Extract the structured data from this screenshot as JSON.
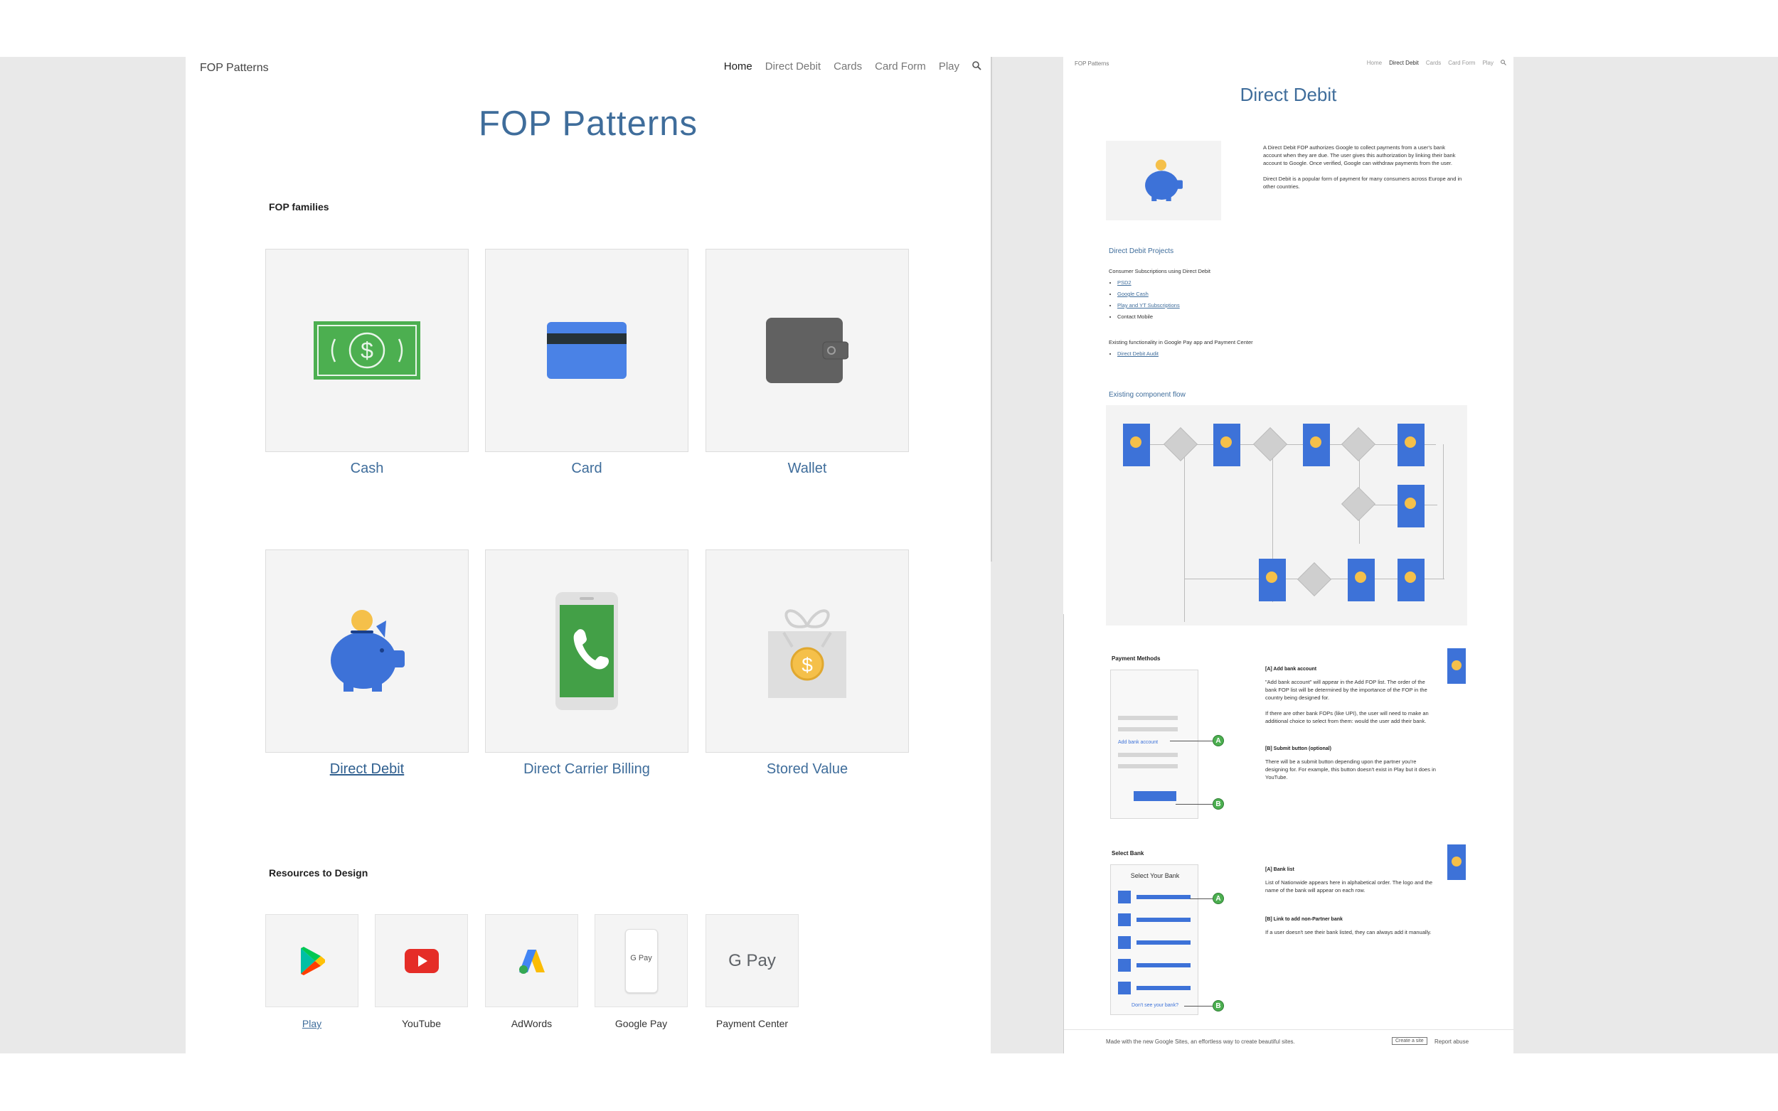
{
  "left_page": {
    "site_name": "FOP Patterns",
    "nav": [
      "Home",
      "Direct Debit",
      "Cards",
      "Card Form",
      "Play"
    ],
    "title": "FOP Patterns",
    "families_heading": "FOP families",
    "families": [
      "Cash",
      "Card",
      "Wallet",
      "Direct Debit",
      "Direct Carrier Billing",
      "Stored Value"
    ],
    "resources_heading": "Resources to Design",
    "resources": [
      "Play",
      "YouTube",
      "AdWords",
      "Google Pay",
      "Payment Center"
    ],
    "gpay_text": "G Pay",
    "gpay_small": "G Pay"
  },
  "right_page": {
    "site_name": "FOP Patterns",
    "nav": [
      "Home",
      "Direct Debit",
      "Cards",
      "Card Form",
      "Play"
    ],
    "title": "Direct Debit",
    "intro_1": "A Direct Debit FOP authorizes Google to collect payments from a user's bank account when they are due. The user gives this authorization by linking their bank account to Google. Once verified, Google can withdraw payments from the user.",
    "intro_2": "Direct Debit is a popular form of payment for many consumers across Europe and in other countries.",
    "projects_heading": "Direct Debit Projects",
    "projects_sub": "Consumer Subscriptions using Direct Debit",
    "projects_list": [
      "PSD2",
      "Google Cash",
      "Play and YT Subscriptions",
      "Contact Mobile"
    ],
    "existing_text": "Existing functionality in Google Pay app and Payment Center",
    "existing_list": [
      "Direct Debit Audit"
    ],
    "flow_heading": "Existing component flow",
    "payment_methods_heading": "Payment Methods",
    "pm_add_bank": "Add bank account",
    "pm_a_title": "[A] Add bank account",
    "pm_a_text_1": "\"Add bank account\" will appear in the Add FOP list. The order of the bank FOP list will be determined by the importance of the FOP in the country being designed for.",
    "pm_a_text_2": "If there are other bank FOPs (like UPI), the user will need to make an additional choice to select from them: would the user add their bank.",
    "pm_b_title": "[B] Submit button (optional)",
    "pm_b_text": "There will be a submit button depending upon the partner you're designing for. For example, this button doesn't exist in Play but it does in YouTube.",
    "select_bank_heading": "Select Bank",
    "sb_mock_title": "Select Your Bank",
    "sb_mock_link": "Don't see your bank?",
    "sb_a_title": "[A] Bank list",
    "sb_a_text": "List of Nationwide appears here in alphabetical order. The logo and the name of the bank will appear on each row.",
    "sb_b_title": "[B] Link to add non-Partner bank",
    "sb_b_text": "If a user doesn't see their bank listed, they can always add it manually.",
    "footer_text": "Made with the new Google Sites, an effortless way to create beautiful sites.",
    "footer_btn": "Create a site",
    "footer_report": "Report abuse",
    "callout_a": "A",
    "callout_b": "B"
  },
  "colors": {
    "title_blue": "#3f6d9b",
    "card_blue": "#3d72d8",
    "coin_yellow": "#f5c04a",
    "green": "#4caf50"
  },
  "icons": [
    "cash-icon",
    "credit-card-icon",
    "wallet-icon",
    "piggy-bank-icon",
    "phone-icon",
    "gift-icon",
    "play-icon",
    "youtube-icon",
    "adwords-icon",
    "google-pay-icon",
    "search-icon"
  ]
}
